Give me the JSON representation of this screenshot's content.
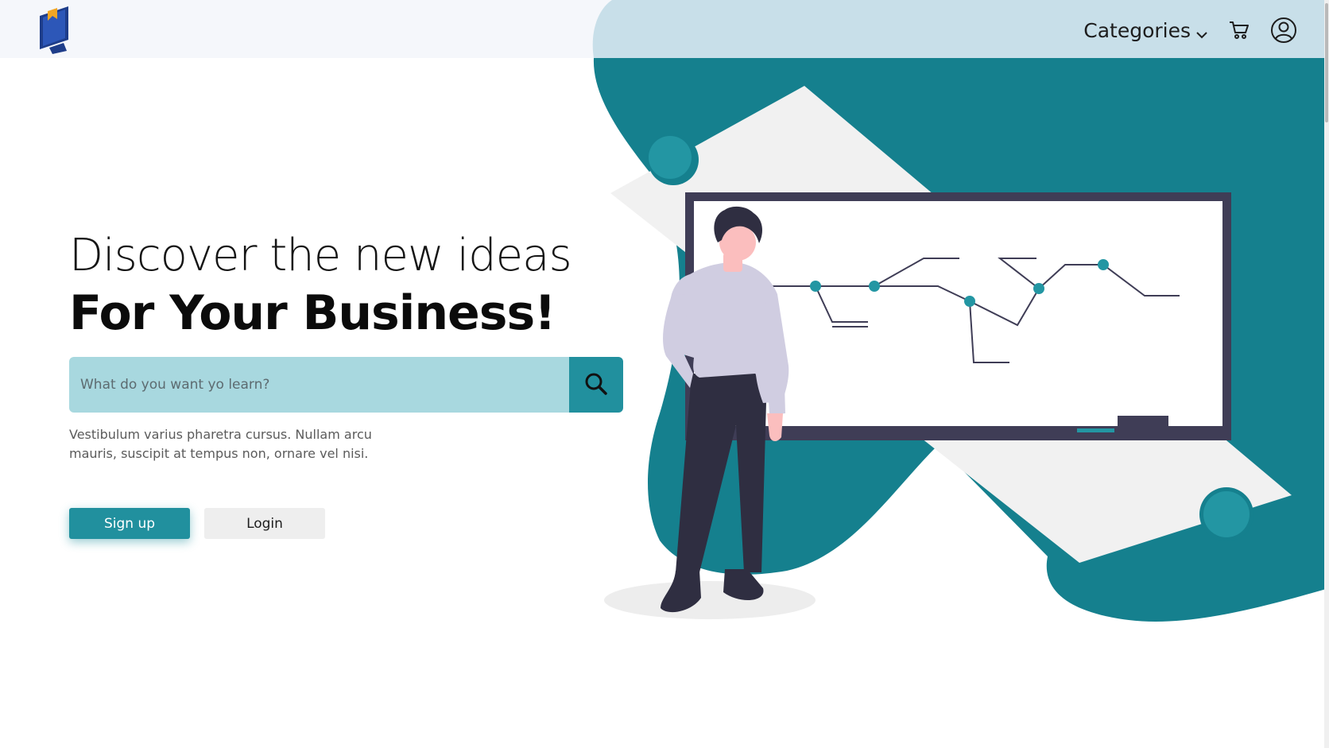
{
  "colors": {
    "accent": "#21909e",
    "accent_dark": "#15808e",
    "search_field_bg": "#a8d8df",
    "header_bg": "#f5f7fb",
    "header_blob": "#c8dfe9"
  },
  "header": {
    "logo_icon": "monitor-book-logo-icon",
    "categories_label": "Categories",
    "categories_icon": "chevron-down-icon",
    "cart_icon": "cart-icon",
    "profile_icon": "user-profile-icon"
  },
  "hero": {
    "title_line1": "Discover the new ideas",
    "title_line2": "For Your Business!",
    "search": {
      "placeholder": "What do you want yo learn?",
      "value": "",
      "button_icon": "search-icon"
    },
    "description": "Vestibulum varius pharetra cursus. Nullam arcu mauris, suscipit at tempus non, ornare vel nisi.",
    "signup_label": "Sign up",
    "login_label": "Login"
  },
  "illustration": {
    "subject": "person-presenting-whiteboard-illustration"
  }
}
